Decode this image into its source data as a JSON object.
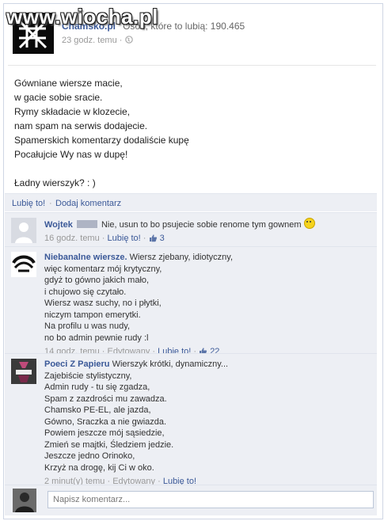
{
  "watermark": "www.wiocha.pl",
  "post": {
    "page_name": "Chamsko.pl",
    "likes_text": "Osób, które to lubią: 190.465",
    "time": "23 godz. temu",
    "body": "Gówniane wiersze macie,\nw gacie sobie sracie.\nRymy składacie w klozecie,\nnam spam na serwis dodajecie.\nSpamerskich komentarzy dodaliście kupę\nPocałujcie Wy nas w dupę!\n\nŁadny wierszyk? : )",
    "like_label": "Lubię to!",
    "comment_label": "Dodaj komentarz"
  },
  "comments": [
    {
      "author": "Wojtek",
      "text": "Nie, usun to bo psujecie sobie renome tym gownem",
      "time": "16 godz. temu",
      "like_label": "Lubię to!",
      "likes": "3"
    },
    {
      "author": "Niebanalne wiersze.",
      "first_line": "Wiersz zjebany, idiotyczny,",
      "text": "więc komentarz mój krytyczny,\ngdyż to gówno jakich mało,\ni chujowo się czytało.\nWiersz wasz suchy, no i płytki,\nniczym tampon emerytki.\nNa profilu u was nudy,\nno bo admin pewnie rudy :l",
      "time": "14 godz. temu",
      "edited": "Edytowany",
      "like_label": "Lubię to!",
      "likes": "22"
    },
    {
      "author": "Poeci Z Papieru",
      "first_line": "Wierszyk krótki, dynamiczny...",
      "text": "Zajebiście stylistyczny,\nAdmin rudy - tu się zgadza,\nSpam z zazdrości mu zawadza.\nChamsko PE-EL, ale jazda,\nGówno, Sraczka a nie gwiazda.\nPowiem jeszcze mój sąsiedzie,\nZmień se majtki, Śledziem jedzie.\nJeszcze jedno Orinoko,\nKrzyż na drogę, kij Ci w oko.",
      "time": "2 minut(y) temu",
      "edited": "Edytowany",
      "like_label": "Lubię to!"
    }
  ],
  "write_comment": {
    "placeholder": "Napisz komentarz..."
  },
  "colors": {
    "link": "#3b5998",
    "panel_bg": "#edeff4"
  }
}
